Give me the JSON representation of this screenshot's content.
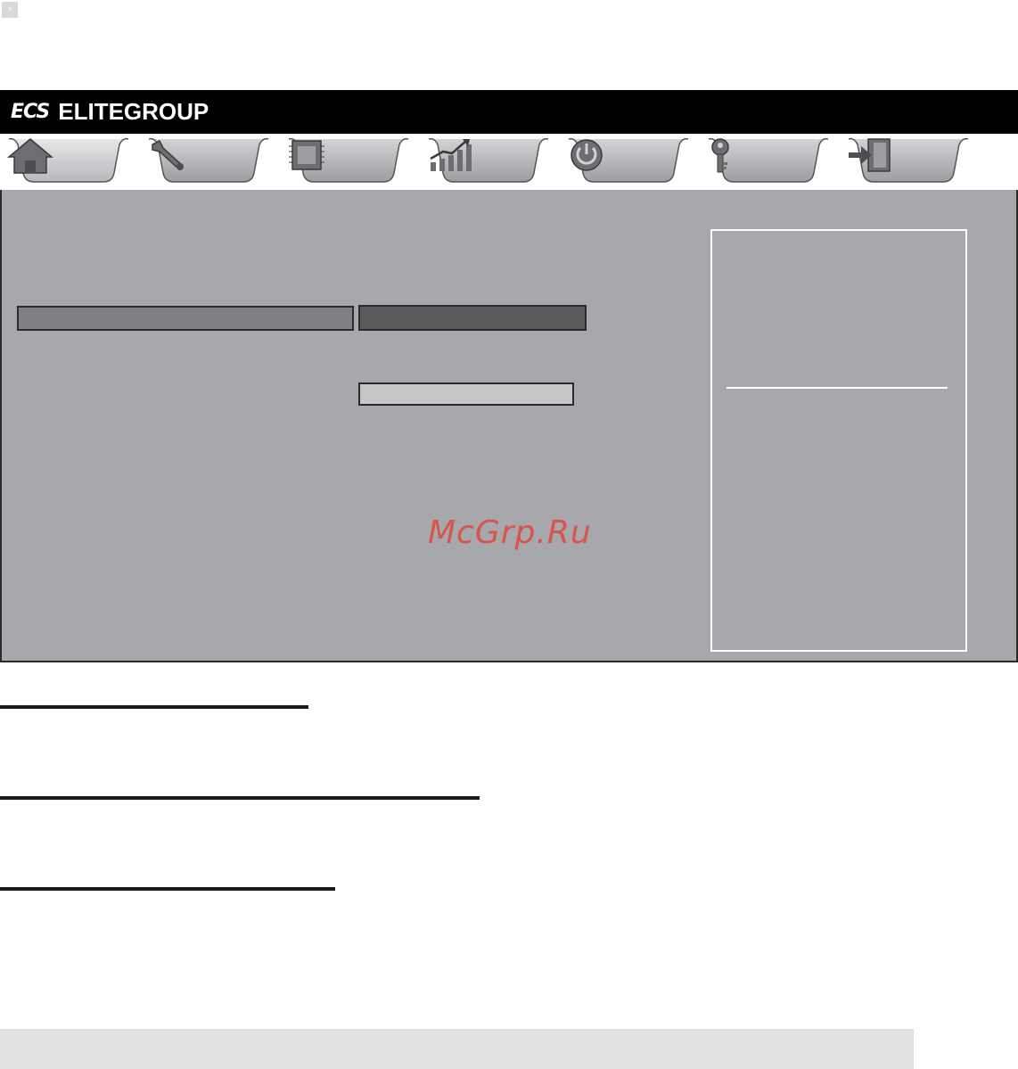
{
  "corner": {
    "icon": "chevron-right-icon"
  },
  "brand": {
    "mark": "ECS",
    "name": "ELITEGROUP"
  },
  "tabs": [
    {
      "icon": "home-icon",
      "active": true
    },
    {
      "icon": "wrench-icon",
      "active": false
    },
    {
      "icon": "chipset-icon",
      "active": false
    },
    {
      "icon": "chart-icon",
      "active": false
    },
    {
      "icon": "power-icon",
      "active": false
    },
    {
      "icon": "key-icon",
      "active": false
    },
    {
      "icon": "exit-icon",
      "active": false
    }
  ],
  "watermark": "McGrp.Ru",
  "colors": {
    "panel": "#a7a8ab",
    "active_tab": "#c8c9cb",
    "inactive_tab": "#b0b1b4",
    "watermark": "#d9534f"
  }
}
